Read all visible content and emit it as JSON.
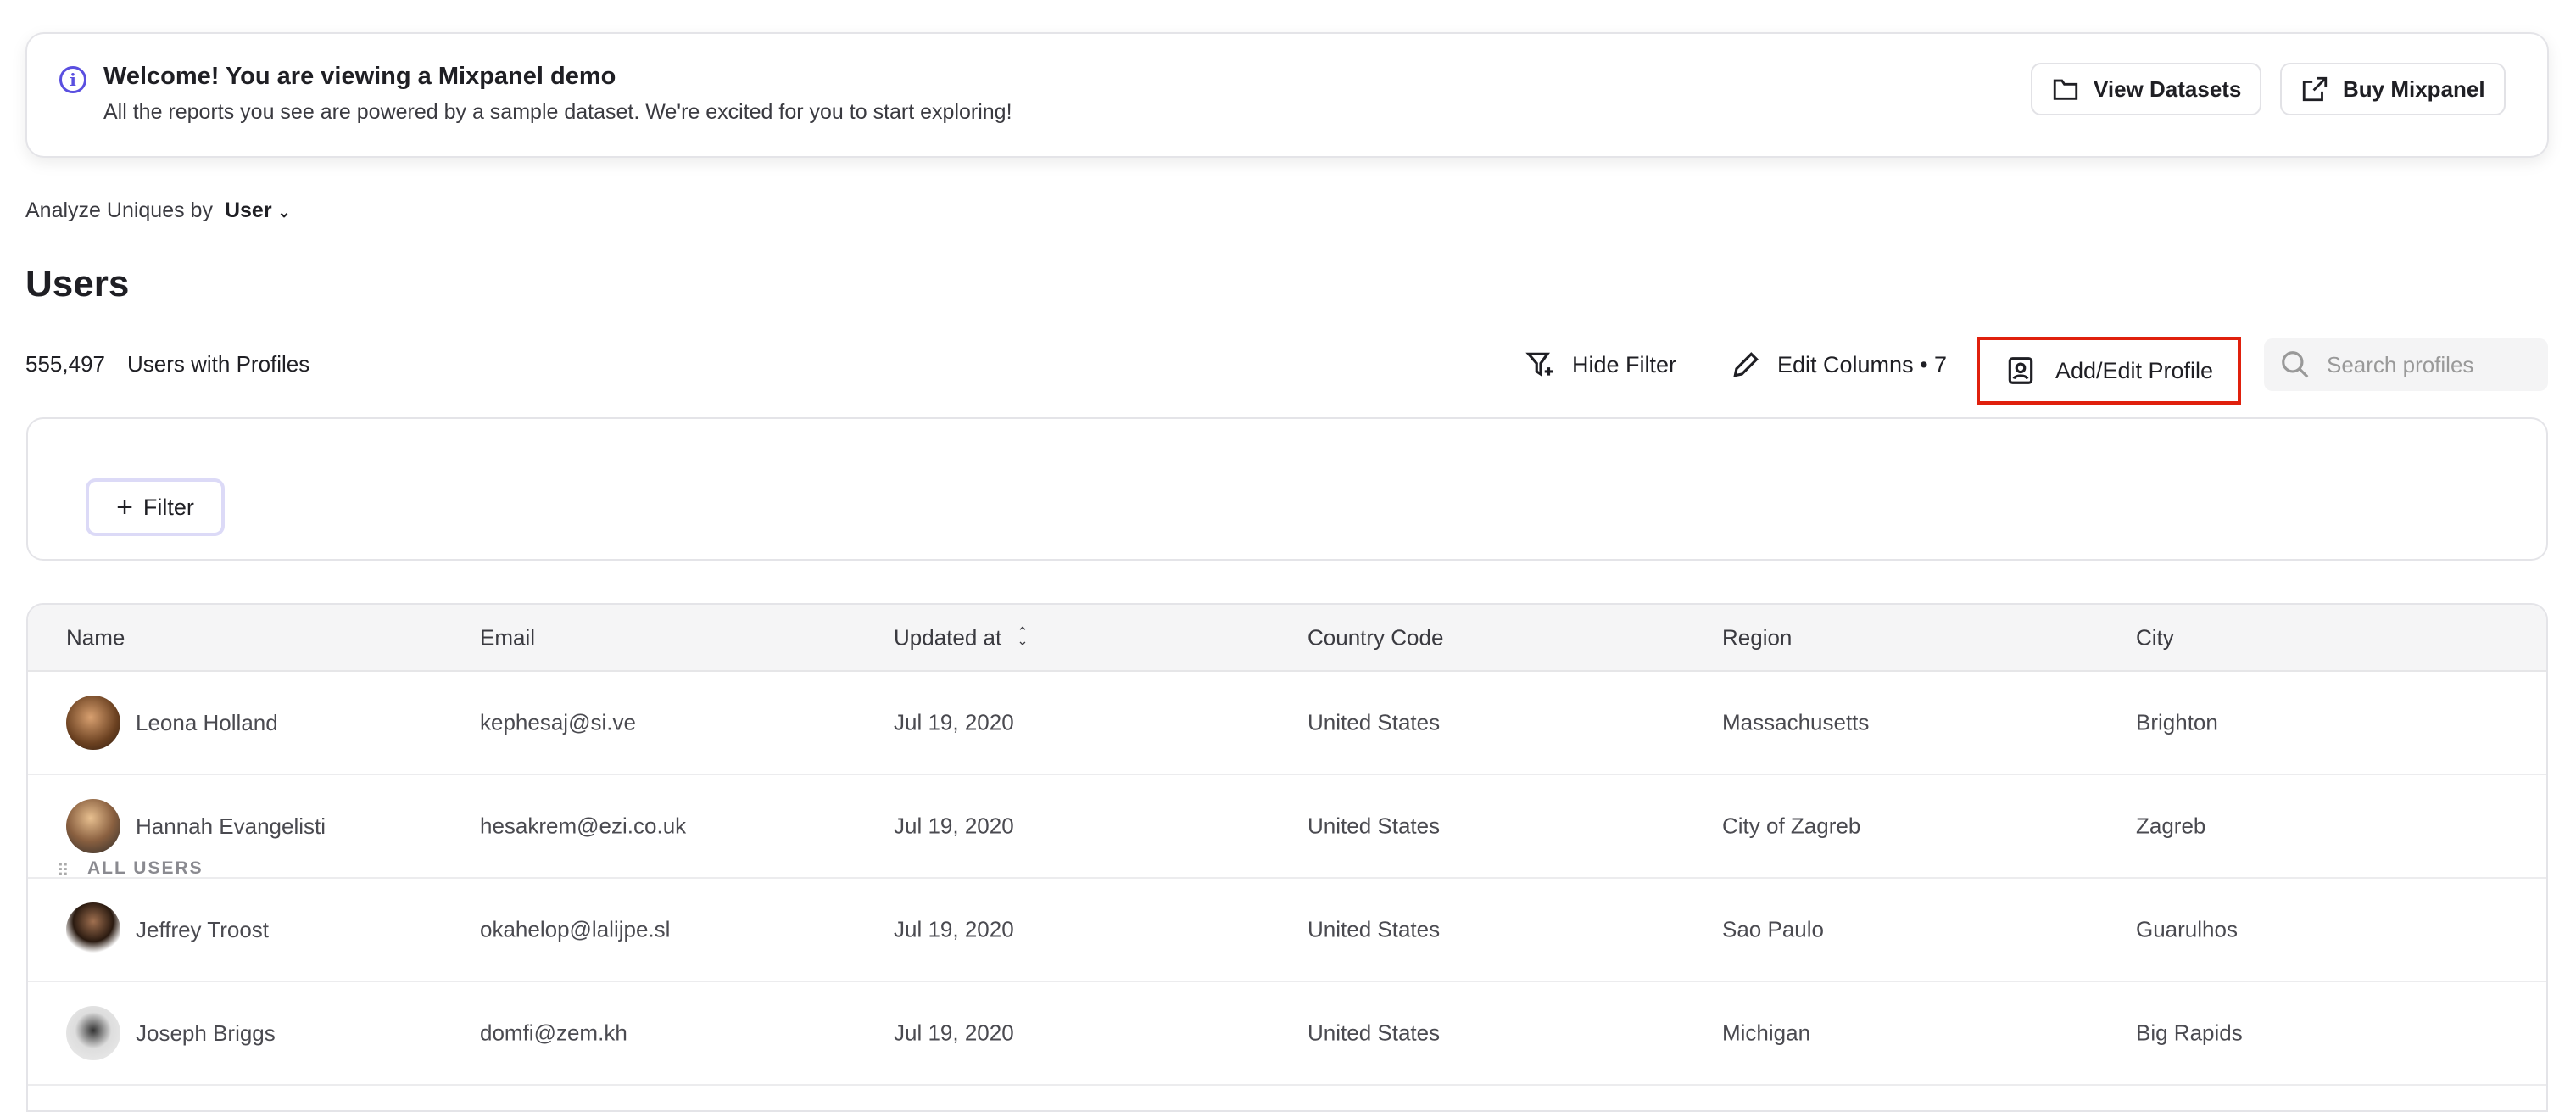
{
  "banner": {
    "title": "Welcome! You are viewing a Mixpanel demo",
    "subtitle": "All the reports you see are powered by a sample dataset. We're excited for you to start exploring!",
    "view_datasets": "View Datasets",
    "buy_mixpanel": "Buy Mixpanel"
  },
  "analyze": {
    "label": "Analyze Uniques by",
    "value": "User"
  },
  "page_title": "Users",
  "count": {
    "value": "555,497",
    "label": "Users with Profiles"
  },
  "toolbar": {
    "hide_filter": "Hide Filter",
    "edit_columns": "Edit Columns • 7",
    "add_edit_profile": "Add/Edit Profile",
    "search_placeholder": "Search profiles"
  },
  "filter": {
    "group_label": "ALL USERS",
    "add_filter": "Filter"
  },
  "table": {
    "columns": [
      "Name",
      "Email",
      "Updated at",
      "Country Code",
      "Region",
      "City"
    ],
    "rows": [
      {
        "name": "Leona Holland",
        "email": "kephesaj@si.ve",
        "updated": "Jul 19, 2020",
        "country": "United States",
        "region": "Massachusetts",
        "city": "Brighton"
      },
      {
        "name": "Hannah Evangelisti",
        "email": "hesakrem@ezi.co.uk",
        "updated": "Jul 19, 2020",
        "country": "United States",
        "region": "City of Zagreb",
        "city": "Zagreb"
      },
      {
        "name": "Jeffrey Troost",
        "email": "okahelop@lalijpe.sl",
        "updated": "Jul 19, 2020",
        "country": "United States",
        "region": "Sao Paulo",
        "city": "Guarulhos"
      },
      {
        "name": "Joseph Briggs",
        "email": "domfi@zem.kh",
        "updated": "Jul 19, 2020",
        "country": "United States",
        "region": "Michigan",
        "city": "Big Rapids"
      }
    ]
  },
  "colors": {
    "accent": "#5a4fe0",
    "highlight": "#e0200d"
  }
}
